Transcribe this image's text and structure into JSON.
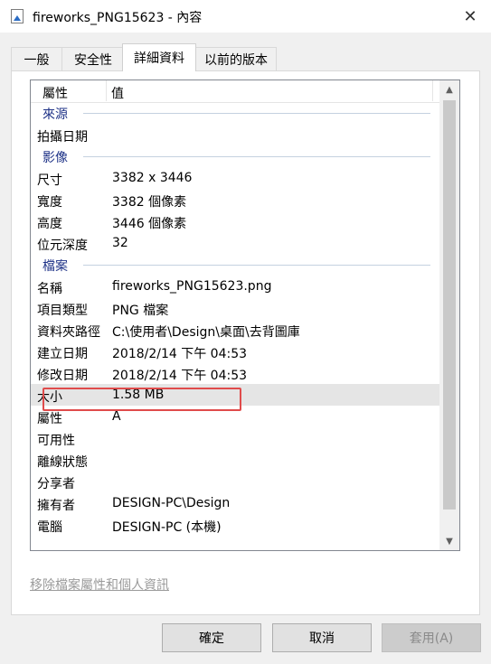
{
  "window": {
    "title": "fireworks_PNG15623 - 內容",
    "close_glyph": "✕"
  },
  "tabs": [
    {
      "label": "一般"
    },
    {
      "label": "安全性"
    },
    {
      "label": "詳細資料"
    },
    {
      "label": "以前的版本"
    }
  ],
  "active_tab": "詳細資料",
  "list": {
    "headers": {
      "property": "屬性",
      "value": "值"
    },
    "groups": {
      "origin": "來源",
      "image": "影像",
      "file": "檔案"
    },
    "origin_rows": [
      {
        "k": "拍攝日期",
        "v": ""
      }
    ],
    "image_rows": [
      {
        "k": "尺寸",
        "v": "3382 x 3446"
      },
      {
        "k": "寬度",
        "v": "3382 個像素"
      },
      {
        "k": "高度",
        "v": "3446 個像素"
      },
      {
        "k": "位元深度",
        "v": "32"
      }
    ],
    "file_rows": [
      {
        "k": "名稱",
        "v": "fireworks_PNG15623.png"
      },
      {
        "k": "項目類型",
        "v": "PNG 檔案"
      },
      {
        "k": "資料夾路徑",
        "v": "C:\\使用者\\Design\\桌面\\去背圖庫"
      },
      {
        "k": "建立日期",
        "v": "2018/2/14 下午 04:53"
      },
      {
        "k": "修改日期",
        "v": "2018/2/14 下午 04:53"
      },
      {
        "k": "大小",
        "v": "1.58 MB"
      },
      {
        "k": "屬性",
        "v": "A"
      },
      {
        "k": "可用性",
        "v": ""
      },
      {
        "k": "離線狀態",
        "v": ""
      },
      {
        "k": "分享者",
        "v": ""
      },
      {
        "k": "擁有者",
        "v": "DESIGN-PC\\Design"
      },
      {
        "k": "電腦",
        "v": "DESIGN-PC (本機)"
      }
    ],
    "selected_row": "大小"
  },
  "scrollbar": {
    "up": "▲",
    "down": "▼"
  },
  "remove_link": "移除檔案屬性和個人資訊",
  "buttons": {
    "ok": "確定",
    "cancel": "取消",
    "apply": "套用(A)"
  }
}
